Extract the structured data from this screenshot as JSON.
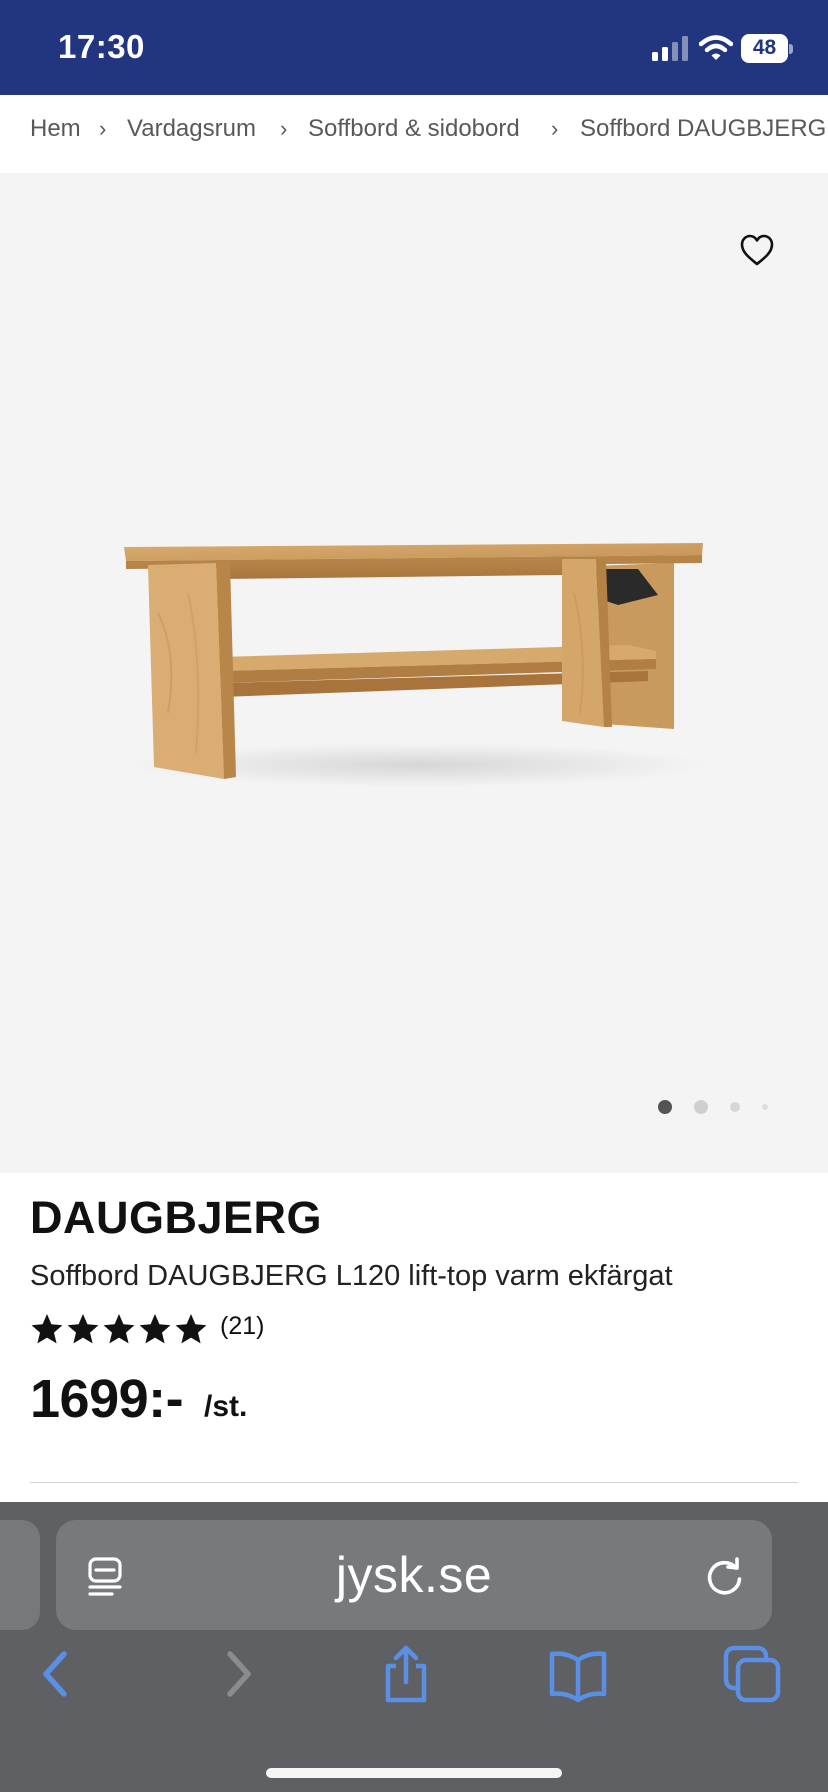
{
  "status_bar": {
    "time": "17:30",
    "battery": "48",
    "background": "#22357f"
  },
  "breadcrumb": {
    "items": [
      "Hem",
      "Vardagsrum",
      "Soffbord & sidobord",
      "Soffbord DAUGBJERG"
    ],
    "separator": "›"
  },
  "gallery": {
    "background": "#f4f4f4",
    "image_alt": "Soffbord DAUGBJERG",
    "current_image": 1,
    "image_count": 4,
    "favorite_icon": "heart-outline-icon"
  },
  "product": {
    "brand": "DAUGBJERG",
    "name": "Soffbord DAUGBJERG L120 lift-top varm ekfärgat",
    "rating": 5,
    "review_count": "(21)",
    "price": "1699:-",
    "price_unit": "/st."
  },
  "browser": {
    "url": "jysk.se",
    "reader_icon": "reader-mode-icon",
    "reload_icon": "reload-icon",
    "toolbar_icons": [
      "back-icon",
      "forward-icon",
      "share-icon",
      "bookmarks-icon",
      "tabs-icon"
    ],
    "accent": "#5a8fe6",
    "toolbar_color": "#5e6063"
  }
}
